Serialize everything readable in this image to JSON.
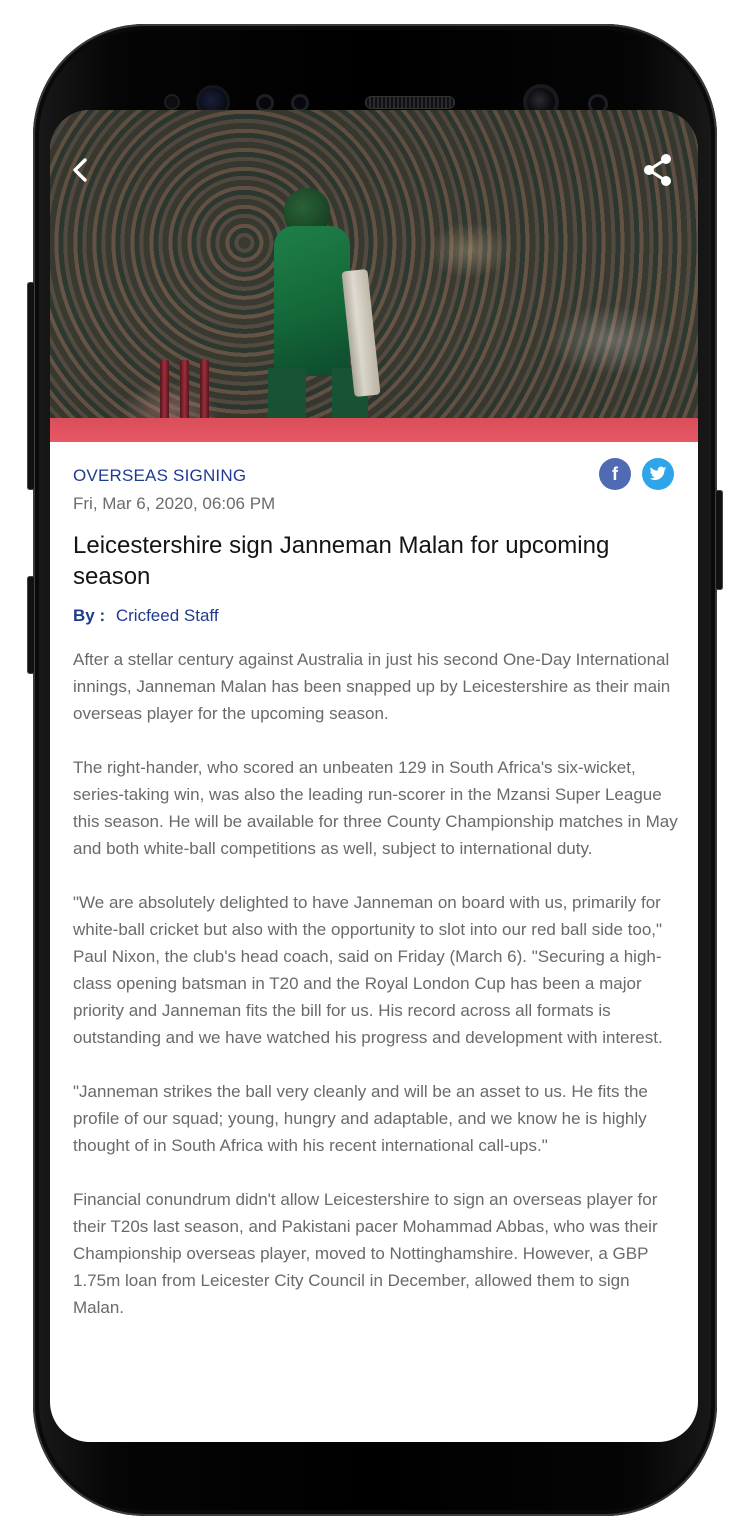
{
  "article": {
    "category": "OVERSEAS SIGNING",
    "date": "Fri, Mar 6, 2020, 06:06 PM",
    "title": "Leicestershire sign Janneman Malan for upcoming season",
    "byline_label": "By :",
    "author": "Cricfeed Staff",
    "paragraphs": [
      "After a stellar century against Australia in just his second One-Day International innings, Janneman Malan has been snapped up by Leicestershire as their main overseas player for the upcoming season.",
      "The right-hander, who scored an unbeaten 129 in South Africa's six-wicket, series-taking win, was also the leading run-scorer in the Mzansi Super League this season. He will be available for three County Championship matches in May and both white-ball competitions as well, subject to international duty.",
      "\"We are absolutely delighted to have Janneman on board with us, primarily for white-ball cricket but also with the opportunity to slot into our red ball side too,\" Paul Nixon, the club's head coach, said on Friday (March 6). \"Securing a high-class opening batsman in T20 and the Royal London Cup has been a major priority and Janneman fits the bill for us. His record across all formats is outstanding and we have watched his progress and development with interest.",
      "\"Janneman strikes the ball very cleanly and will be an asset to us. He fits the profile of our squad; young, hungry and adaptable, and we know he is highly thought of in South Africa with his recent international call-ups.\"",
      "Financial conundrum didn't allow Leicestershire to sign an overseas player for their T20s last season, and Pakistani pacer Mohammad Abbas, who was their Championship overseas player, moved to Nottinghamshire. However, a GBP 1.75m loan from Leicester City Council in December, allowed them to sign Malan."
    ]
  },
  "share": {
    "facebook_glyph": "f",
    "facebook_color": "#4f6bb4",
    "twitter_color": "#2ea5e8"
  },
  "icons": {
    "back": "back-arrow-icon",
    "share": "share-icon"
  },
  "colors": {
    "accent": "#1f3b8f",
    "body_text": "#6a6a6a",
    "title_text": "#141414"
  }
}
